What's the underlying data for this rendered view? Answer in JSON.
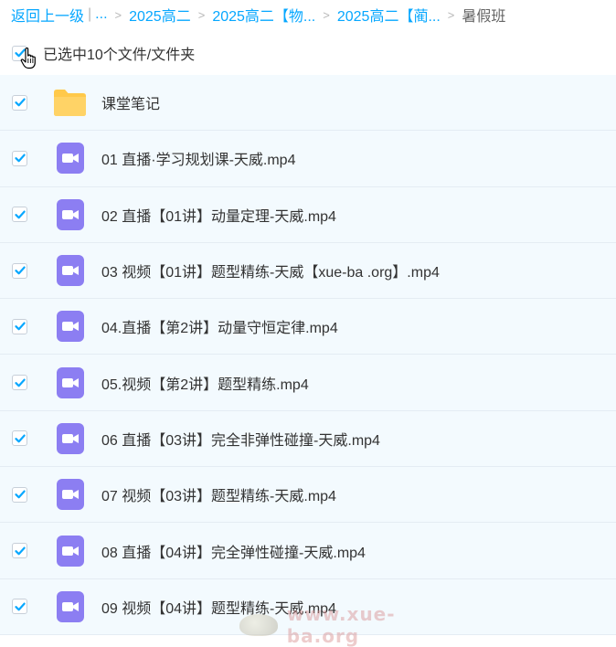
{
  "breadcrumb": {
    "back": "返回上一级",
    "pipe": "|",
    "ellipsis": "...",
    "items": [
      "2025高二",
      "2025高二【物...",
      "2025高二【蔺..."
    ],
    "current": "暑假班"
  },
  "selection": {
    "text": "已选中10个文件/文件夹",
    "checked": true
  },
  "files": [
    {
      "name": "课堂笔记",
      "type": "folder"
    },
    {
      "name": "01 直播·学习规划课-天威.mp4",
      "type": "video"
    },
    {
      "name": "02 直播【01讲】动量定理-天威.mp4",
      "type": "video"
    },
    {
      "name": "03 视频【01讲】题型精练-天威【xue-ba .org】.mp4",
      "type": "video"
    },
    {
      "name": "04.直播【第2讲】动量守恒定律.mp4",
      "type": "video"
    },
    {
      "name": "05.视频【第2讲】题型精练.mp4",
      "type": "video"
    },
    {
      "name": "06 直播【03讲】完全非弹性碰撞-天威.mp4",
      "type": "video"
    },
    {
      "name": "07 视频【03讲】题型精练-天威.mp4",
      "type": "video"
    },
    {
      "name": "08 直播【04讲】完全弹性碰撞-天威.mp4",
      "type": "video"
    },
    {
      "name": "09 视频【04讲】题型精练-天威.mp4",
      "type": "video"
    }
  ],
  "watermark": {
    "text": "www.xue-ba.org"
  },
  "colors": {
    "link": "#06a7ff",
    "check": "#06a7ff",
    "folder": "#ffc94a",
    "video": "#8c7ef2",
    "row_bg": "#f3fafe"
  }
}
